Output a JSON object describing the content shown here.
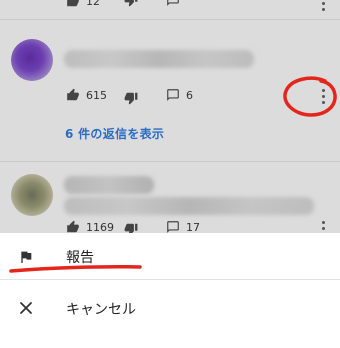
{
  "comments": [
    {
      "likes": "615",
      "replies_count": "6"
    },
    {
      "likes": "1169",
      "replies_count": "17"
    }
  ],
  "top_partial": {
    "likes": "12"
  },
  "view_replies_label": "6 件の返信を表示",
  "sheet": {
    "report_label": "報告",
    "cancel_label": "キャンセル"
  },
  "colors": {
    "annotation": "#e3261b",
    "link": "#2b6cc4",
    "dim_overlay": "#dcdcdc"
  }
}
